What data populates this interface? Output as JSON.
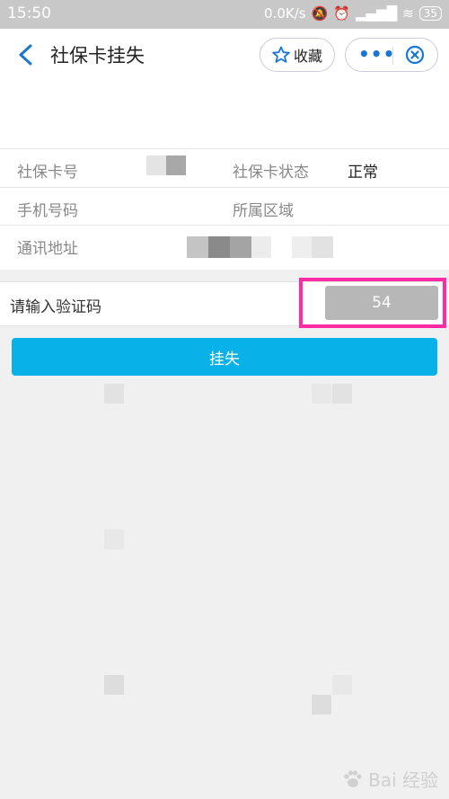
{
  "status_bar": {
    "time": "15:50",
    "net_speed": "0.0K/s",
    "battery": "35"
  },
  "header": {
    "title": "社保卡挂失",
    "favorite_label": "收藏",
    "more_icon": "more-dots-icon",
    "close_icon": "close-circle-icon"
  },
  "info": {
    "card_number_label": "社保卡号",
    "card_status_label": "社保卡状态",
    "card_status_value": "正常",
    "phone_label": "手机号码",
    "region_label": "所属区域",
    "address_label": "通讯地址"
  },
  "verify": {
    "label": "请输入验证码",
    "code": "54"
  },
  "submit_label": "挂失",
  "watermark": "Bai 经验",
  "colors": {
    "accent": "#08b2e9",
    "highlight": "#ff2aa4"
  }
}
